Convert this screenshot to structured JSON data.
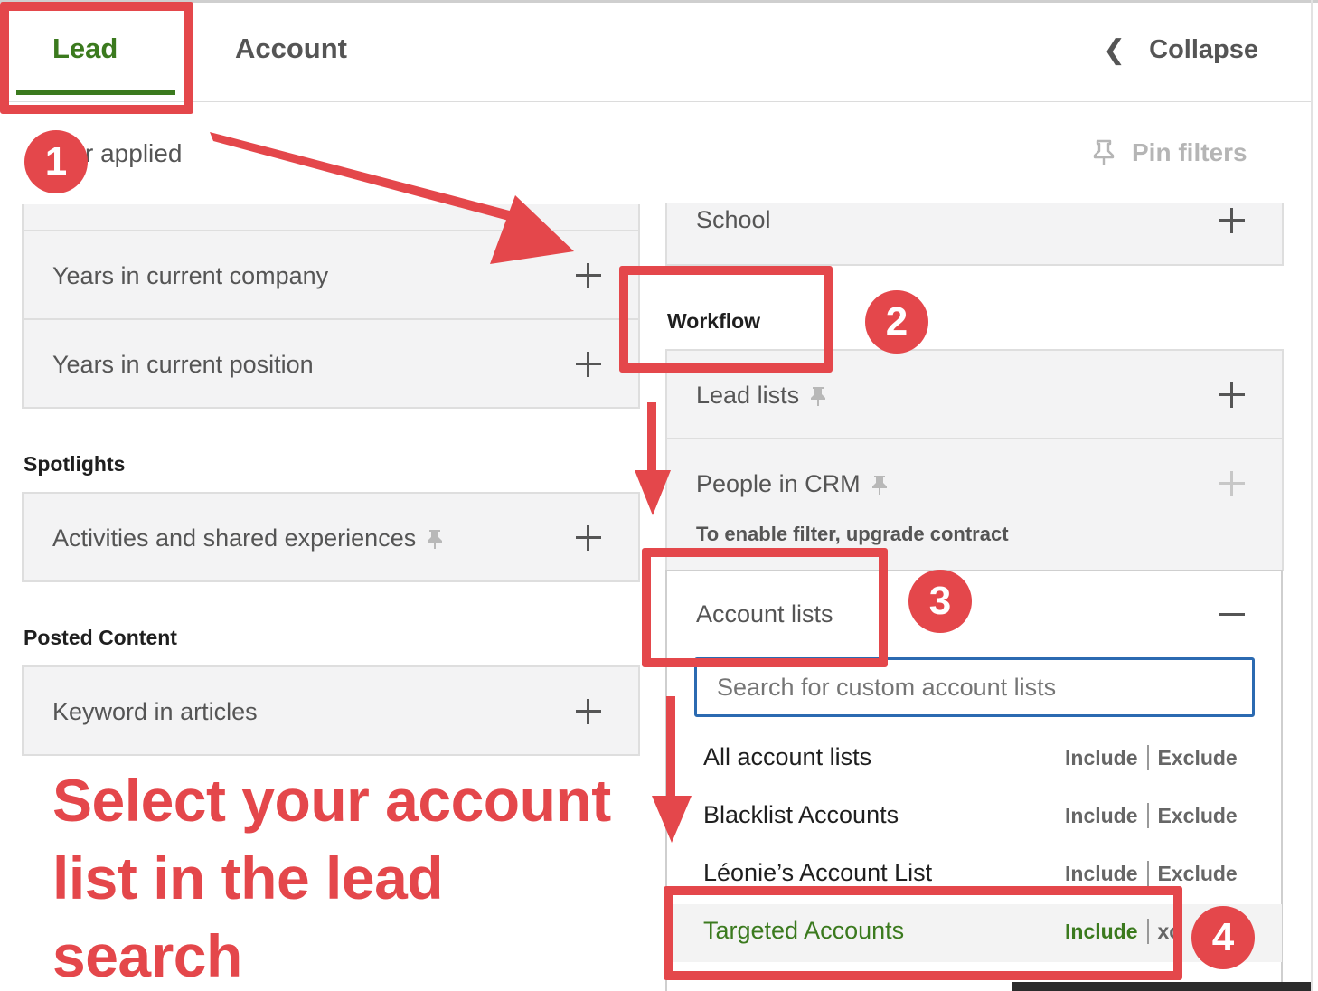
{
  "header": {
    "tabs": [
      {
        "label": "Lead",
        "active": true
      },
      {
        "label": "Account",
        "active": false
      }
    ],
    "collapse_label": "Collapse"
  },
  "subheader": {
    "applied_text": "r applied",
    "pin_filters_label": "Pin filters"
  },
  "left_column": {
    "filters": [
      {
        "label": "Years in current company"
      },
      {
        "label": "Years in current position"
      }
    ],
    "spotlights": {
      "heading": "Spotlights",
      "filters": [
        {
          "label": "Activities and shared experiences",
          "pinned": true
        }
      ]
    },
    "posted_content": {
      "heading": "Posted Content",
      "filters": [
        {
          "label": "Keyword in articles"
        }
      ]
    }
  },
  "right_column": {
    "school": {
      "label": "School"
    },
    "workflow": {
      "heading": "Workflow",
      "lead_lists": {
        "label": "Lead lists",
        "pinned": true
      },
      "people_in_crm": {
        "label": "People in CRM",
        "pinned": true,
        "notice": "To enable filter, upgrade contract"
      },
      "account_lists": {
        "label": "Account lists",
        "search_placeholder": "Search for custom account lists",
        "include_label": "Include",
        "exclude_label": "Exclude",
        "items": [
          {
            "name": "All account lists"
          },
          {
            "name": "Blacklist Accounts"
          },
          {
            "name": "Léonie’s Account List"
          },
          {
            "name": "Targeted Accounts",
            "highlighted": true,
            "exclude_partial": "xc"
          }
        ]
      }
    }
  },
  "annotations": {
    "badges": [
      "1",
      "2",
      "3",
      "4"
    ],
    "caption": "Select your account list in the lead search",
    "accent_color": "#e4474b"
  },
  "colors": {
    "active_tab": "#3b7a1e",
    "focus_border": "#2b6ab1",
    "card_bg": "#f3f3f4"
  }
}
